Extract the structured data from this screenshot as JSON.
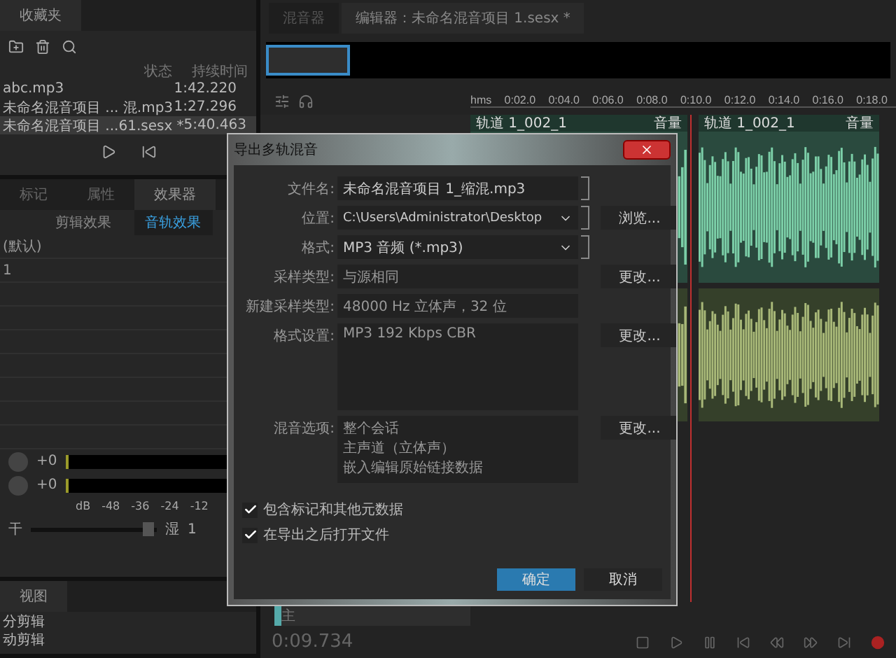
{
  "files_panel": {
    "tab": "收藏夹",
    "columns": [
      "状态",
      "持续时间"
    ],
    "rows": [
      {
        "name": "abc.mp3",
        "duration": "1:42.220",
        "selected": false
      },
      {
        "name": "未命名混音项目 ... 混.mp3",
        "duration": "1:27.296",
        "selected": false
      },
      {
        "name": "未命名混音项目 ...61.sesx *",
        "duration": "5:40.463",
        "selected": true
      }
    ]
  },
  "effects_panel": {
    "tabs": [
      {
        "label": "标记",
        "selected": false
      },
      {
        "label": "属性",
        "selected": false
      },
      {
        "label": "效果器",
        "selected": true
      }
    ],
    "subtabs": [
      {
        "label": "剪辑效果",
        "selected": false
      },
      {
        "label": "音轨效果",
        "selected": true
      }
    ],
    "preset": "(默认)",
    "slot": "1",
    "gains": [
      "+0",
      "+0"
    ],
    "meter_ticks": [
      "dB",
      "-48",
      "-36",
      "-24",
      "-12"
    ],
    "mix": {
      "start": "干",
      "end": "湿",
      "value": "1",
      "level": 0.93
    }
  },
  "view_panel": {
    "tab": "视图",
    "rows": [
      "分剪辑",
      "动剪辑"
    ]
  },
  "editor": {
    "tabs": [
      {
        "label": "混音器",
        "selected": false
      },
      {
        "label": "编辑器：未命名混音项目 1.sesx *",
        "selected": true
      }
    ],
    "ruler": [
      "hms",
      "0:02.0",
      "0:04.0",
      "0:06.0",
      "0:08.0",
      "0:10.0",
      "0:12.0",
      "0:14.0",
      "0:16.0",
      "0:18.0"
    ],
    "clips": [
      {
        "name": "轨道 1_002_1",
        "label": "音量"
      },
      {
        "name": "轨道 1_002_1",
        "label": "音量"
      }
    ],
    "track_name": "主",
    "time": "0:09.734"
  },
  "dialog": {
    "title": "导出多轨混音",
    "fields": [
      {
        "kind": "input",
        "label": "文件名:",
        "value": "未命名混音项目 1_缩混.mp3"
      },
      {
        "kind": "select",
        "label": "位置:",
        "value": "C:\\Users\\Administrator\\Desktop",
        "button": "浏览..."
      },
      {
        "kind": "select",
        "label": "格式:",
        "value": "MP3 音频 (*.mp3)"
      },
      {
        "kind": "readonly",
        "label": "采样类型:",
        "value": "与源相同",
        "button": "更改..."
      },
      {
        "kind": "readonly",
        "label": "新建采样类型:",
        "value": "48000 Hz 立体声，32 位"
      },
      {
        "kind": "area",
        "label": "格式设置:",
        "lines": [
          "MP3 192 Kbps CBR"
        ],
        "button": "更改..."
      },
      {
        "kind": "area",
        "label": "混音选项:",
        "lines": [
          "整个会话",
          "主声道（立体声）",
          "嵌入编辑原始链接数据"
        ],
        "button": "更改..."
      }
    ],
    "checkboxes": [
      {
        "label": "包含标记和其他元数据",
        "checked": true
      },
      {
        "label": "在导出之后打开文件",
        "checked": true
      }
    ],
    "buttons": [
      {
        "label": "确定",
        "kind": "primary"
      },
      {
        "label": "取消",
        "kind": "secondary"
      }
    ]
  }
}
